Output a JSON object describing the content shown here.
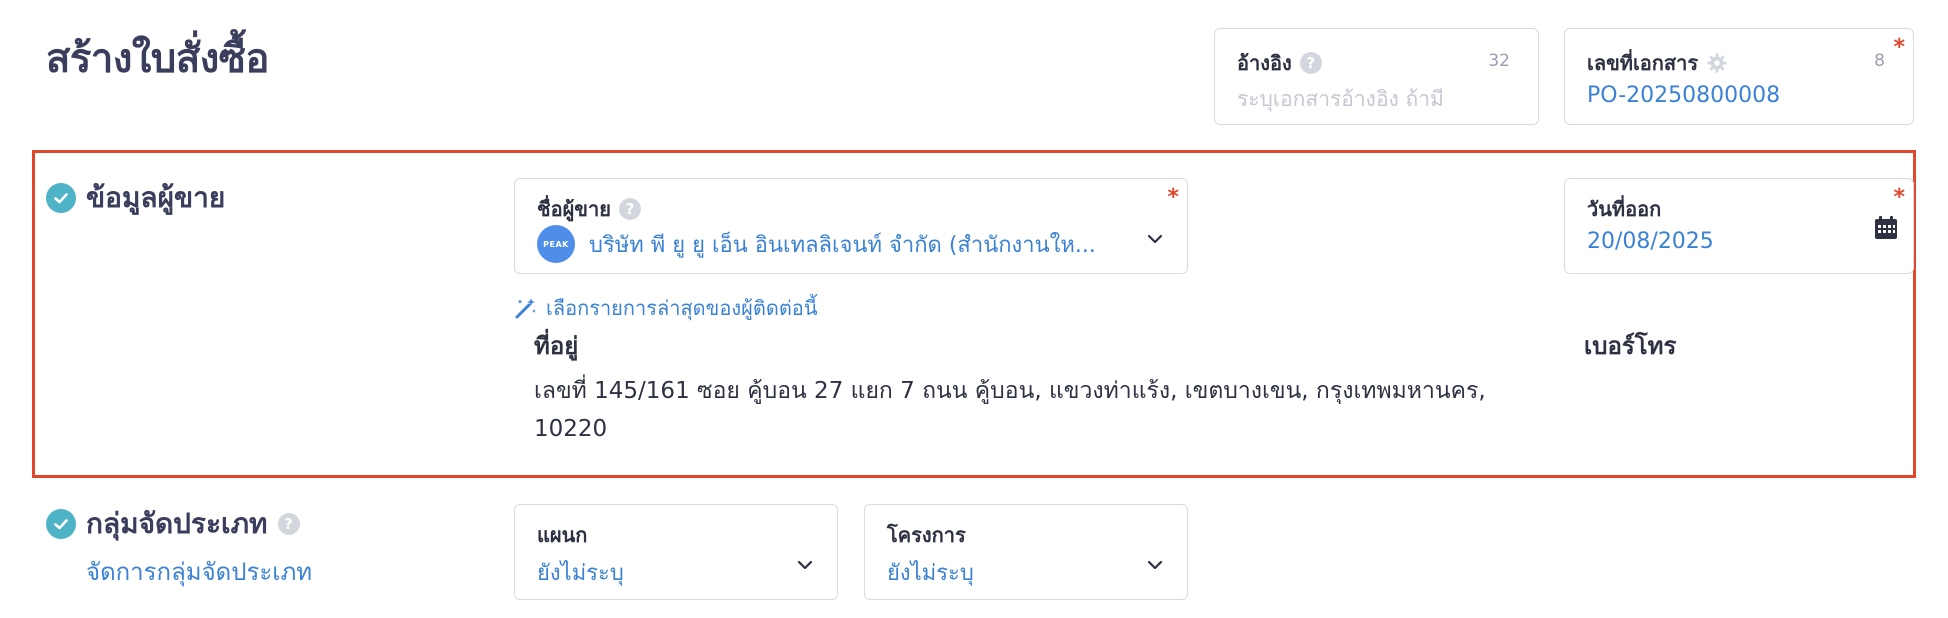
{
  "page": {
    "title": "สร้างใบสั่งซื้อ"
  },
  "reference": {
    "label": "อ้างอิง",
    "placeholder": "ระบุเอกสารอ้างอิง ถ้ามี",
    "count": "32"
  },
  "doc_number": {
    "label": "เลขที่เอกสาร",
    "value": "PO-20250800008",
    "count": "8",
    "required": "*"
  },
  "vendor_section": {
    "title": "ข้อมูลผู้ขาย",
    "vendor_field": {
      "label": "ชื่อผู้ขาย",
      "logo_text": "PEAK",
      "value": "บริษัท พี ยู ยู เอ็น อินเทลลิเจนท์ จำกัด (สำนักงานให...",
      "required": "*"
    },
    "date_field": {
      "label": "วันที่ออก",
      "value": "20/08/2025",
      "required": "*"
    },
    "suggest_link": "เลือกรายการล่าสุดของผู้ติดต่อนี้",
    "address_label": "ที่อยู่",
    "address_value": "เลขที่ 145/161 ซอย คู้บอน 27 แยก 7 ถนน คู้บอน, แขวงท่าแร้ง, เขตบางเขน, กรุงเทพมหานคร, 10220",
    "phone_label": "เบอร์โทร"
  },
  "category_section": {
    "title": "กลุ่มจัดประเภท",
    "manage_link": "จัดการกลุ่มจัดประเภท",
    "department": {
      "label": "แผนก",
      "value": "ยังไม่ระบุ"
    },
    "project": {
      "label": "โครงการ",
      "value": "ยังไม่ระบุ"
    }
  },
  "colors": {
    "accent": "#3b82d6",
    "required": "#e0472b",
    "check": "#4fb3c8",
    "highlight_frame": "#e0472b"
  }
}
